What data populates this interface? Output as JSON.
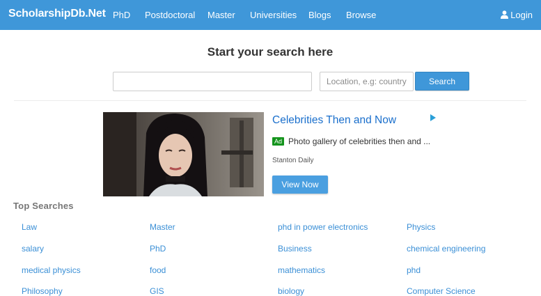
{
  "header": {
    "brand": "ScholarshipDb.Net",
    "nav": [
      "PhD",
      "Postdoctoral",
      "Master",
      "Universities",
      "Blogs",
      "Browse"
    ],
    "login": "Login"
  },
  "search": {
    "title": "Start your search here",
    "keyword_value": "",
    "location_placeholder": "Location, e.g: country,",
    "button": "Search"
  },
  "ad": {
    "title": "Celebrities Then and Now",
    "badge": "Ad",
    "description": "Photo gallery of celebrities then and ...",
    "source": "Stanton Daily",
    "cta": "View Now"
  },
  "top_searches": {
    "heading": "Top Searches",
    "rows": [
      [
        "Law",
        "Master",
        "phd in power electronics",
        "Physics"
      ],
      [
        "salary",
        "PhD",
        "Business",
        "chemical engineering"
      ],
      [
        "medical physics",
        "food",
        "mathematics",
        "phd"
      ],
      [
        "Philosophy",
        "GIS",
        "biology",
        "Computer Science"
      ]
    ]
  },
  "colors": {
    "navbar": "#3f97d9",
    "link": "#3a8fd6",
    "ad_title": "#1a6fcc",
    "ad_badge": "#15941d"
  }
}
